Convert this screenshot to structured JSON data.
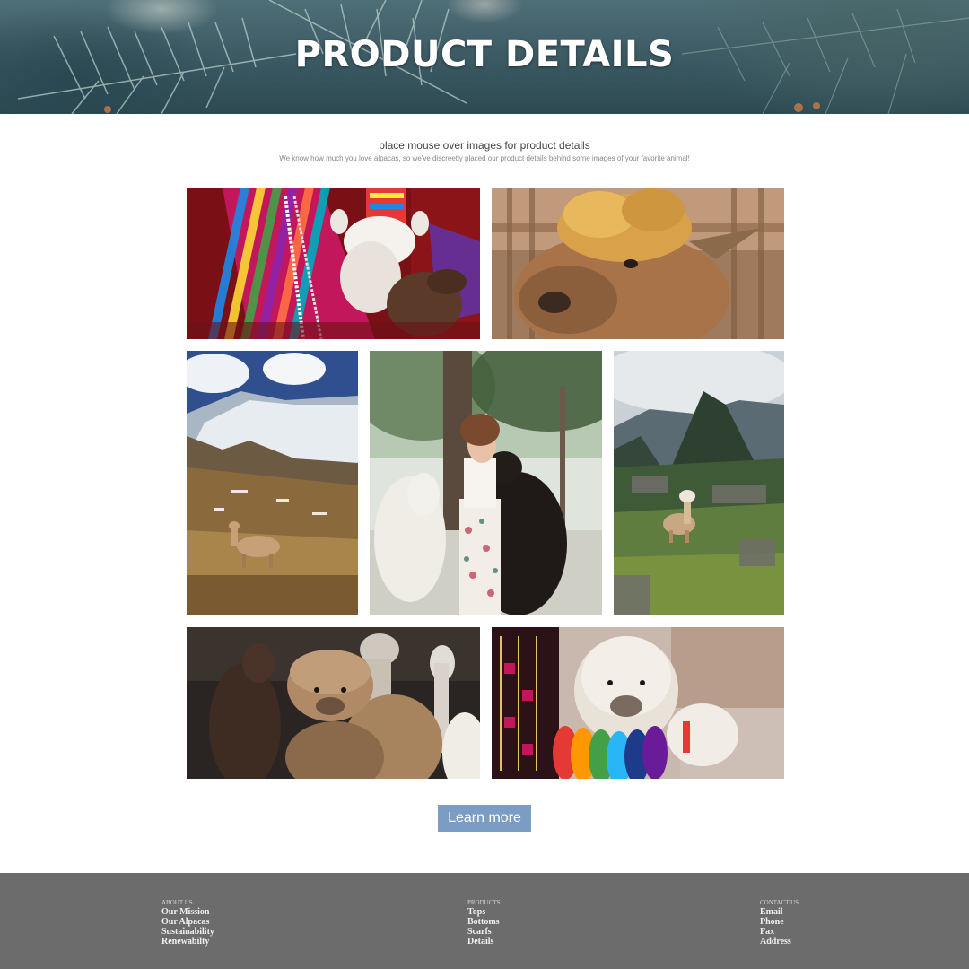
{
  "hero": {
    "title": "PRODUCT DETAILS"
  },
  "intro": {
    "title": "place mouse over images for product details",
    "subtitle": "We know how much you love alpacas, so we've discreetly placed our product details behind some images of your favorite animal!"
  },
  "gallery": {
    "images": [
      {
        "subject": "alpaca-lamb-held-colorful-textile"
      },
      {
        "subject": "alpaca-fluffy-head-closeup"
      },
      {
        "subject": "alpaca-mountain-snow"
      },
      {
        "subject": "woman-kissing-alpacas"
      },
      {
        "subject": "alpaca-machu-picchu"
      },
      {
        "subject": "alpacas-group-dark"
      },
      {
        "subject": "alpaca-rainbow-tassels"
      }
    ]
  },
  "cta": {
    "label": "Learn more"
  },
  "footer": {
    "columns": [
      {
        "heading": "ABOUT US",
        "links": [
          "Our Mission",
          "Our Alpacas",
          "Sustainability",
          "Renewabilty"
        ]
      },
      {
        "heading": "PRODUCTS",
        "links": [
          "Tops",
          "Bottoms",
          "Scarfs",
          "Details"
        ]
      },
      {
        "heading": "CONTACT US",
        "links": [
          "Email",
          "Phone",
          "Fax",
          "Address"
        ]
      }
    ]
  }
}
